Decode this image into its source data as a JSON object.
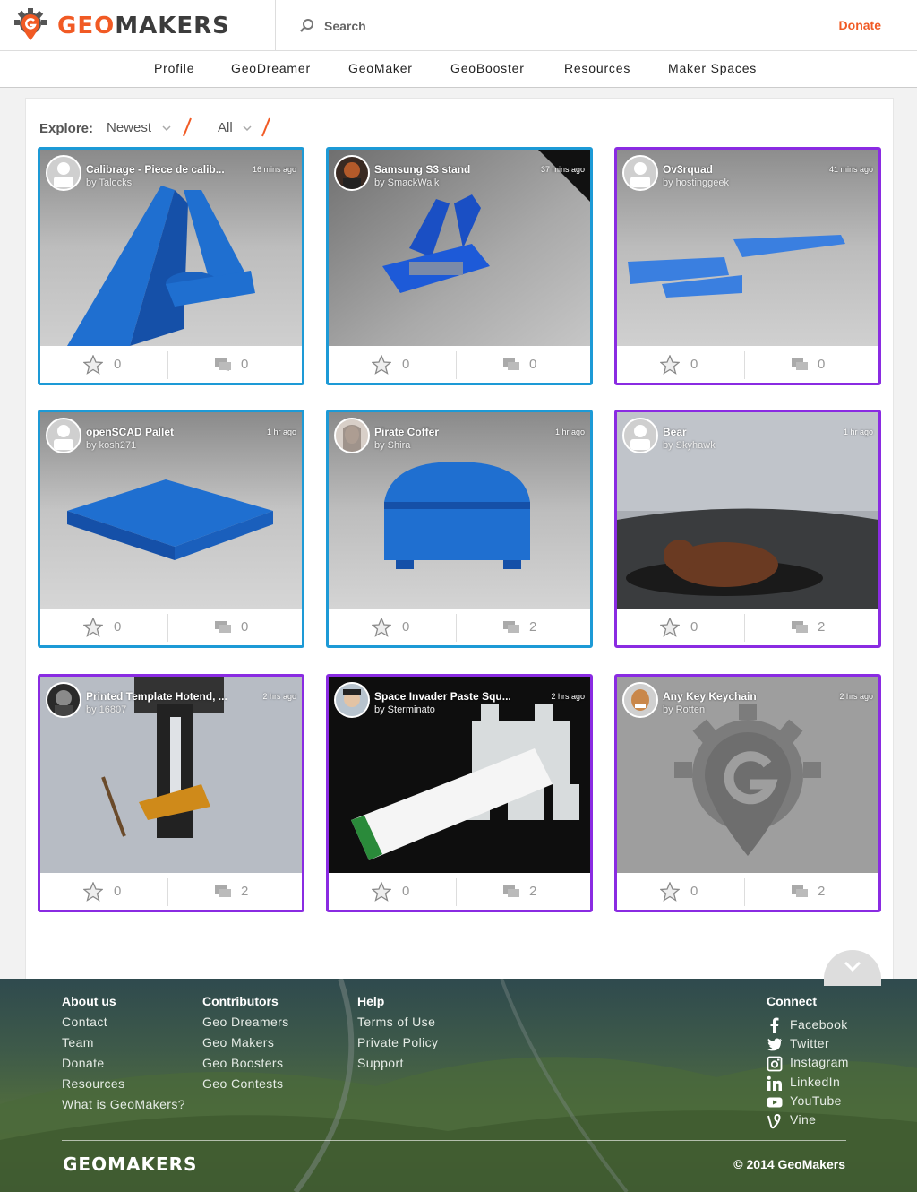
{
  "header": {
    "logo_geo": "GEO",
    "logo_makers": "MAKERS",
    "search_label": "Search",
    "donate_label": "Donate",
    "accent": "#f15a24"
  },
  "nav": {
    "items": [
      "Profile",
      "GeoDreamer",
      "GeoMaker",
      "GeoBooster",
      "Resources",
      "Maker Spaces"
    ]
  },
  "explore": {
    "label": "Explore:",
    "sort_value": "Newest",
    "filter_value": "All"
  },
  "cards": [
    {
      "title": "Calibrage - Piece de calib...",
      "author": "by Talocks",
      "time": "16 mins ago",
      "likes": "0",
      "comments": "0",
      "border": "blue"
    },
    {
      "title": "Samsung S3 stand",
      "author": "by SmackWalk",
      "time": "37 mins ago",
      "likes": "0",
      "comments": "0",
      "border": "blue"
    },
    {
      "title": "Ov3rquad",
      "author": "by hostinggeek",
      "time": "41 mins ago",
      "likes": "0",
      "comments": "0",
      "border": "purple"
    },
    {
      "title": "openSCAD Pallet",
      "author": "by kosh271",
      "time": "1 hr ago",
      "likes": "0",
      "comments": "0",
      "border": "blue"
    },
    {
      "title": "Pirate Coffer",
      "author": "by Shira",
      "time": "1 hr ago",
      "likes": "0",
      "comments": "2",
      "border": "blue"
    },
    {
      "title": "Bear",
      "author": "by Skyhawk",
      "time": "1 hr ago",
      "likes": "0",
      "comments": "2",
      "border": "purple"
    },
    {
      "title": "Printed Template Hotend, ...",
      "author": "by 16807",
      "time": "2 hrs ago",
      "likes": "0",
      "comments": "2",
      "border": "purple"
    },
    {
      "title": "Space Invader Paste Squ...",
      "author": "by Sterminato",
      "time": "2 hrs ago",
      "likes": "0",
      "comments": "2",
      "border": "purple"
    },
    {
      "title": "Any Key Keychain",
      "author": "by Rotten",
      "time": "2 hrs ago",
      "likes": "0",
      "comments": "2",
      "border": "purple"
    }
  ],
  "footer": {
    "about": {
      "heading": "About us",
      "links": [
        "Contact",
        "Team",
        "Donate",
        "Resources",
        "What is GeoMakers?"
      ]
    },
    "contributors": {
      "heading": "Contributors",
      "links": [
        "Geo Dreamers",
        "Geo Makers",
        "Geo Boosters",
        "Geo Contests"
      ]
    },
    "help": {
      "heading": "Help",
      "links": [
        "Terms of Use",
        "Private Policy",
        "Support"
      ]
    },
    "connect": {
      "heading": "Connect",
      "links": [
        "Facebook",
        "Twitter",
        "Instagram",
        "LinkedIn",
        "YouTube",
        "Vine"
      ]
    },
    "logo": "GEOMAKERS",
    "copyright": "© 2014 GeoMakers"
  }
}
